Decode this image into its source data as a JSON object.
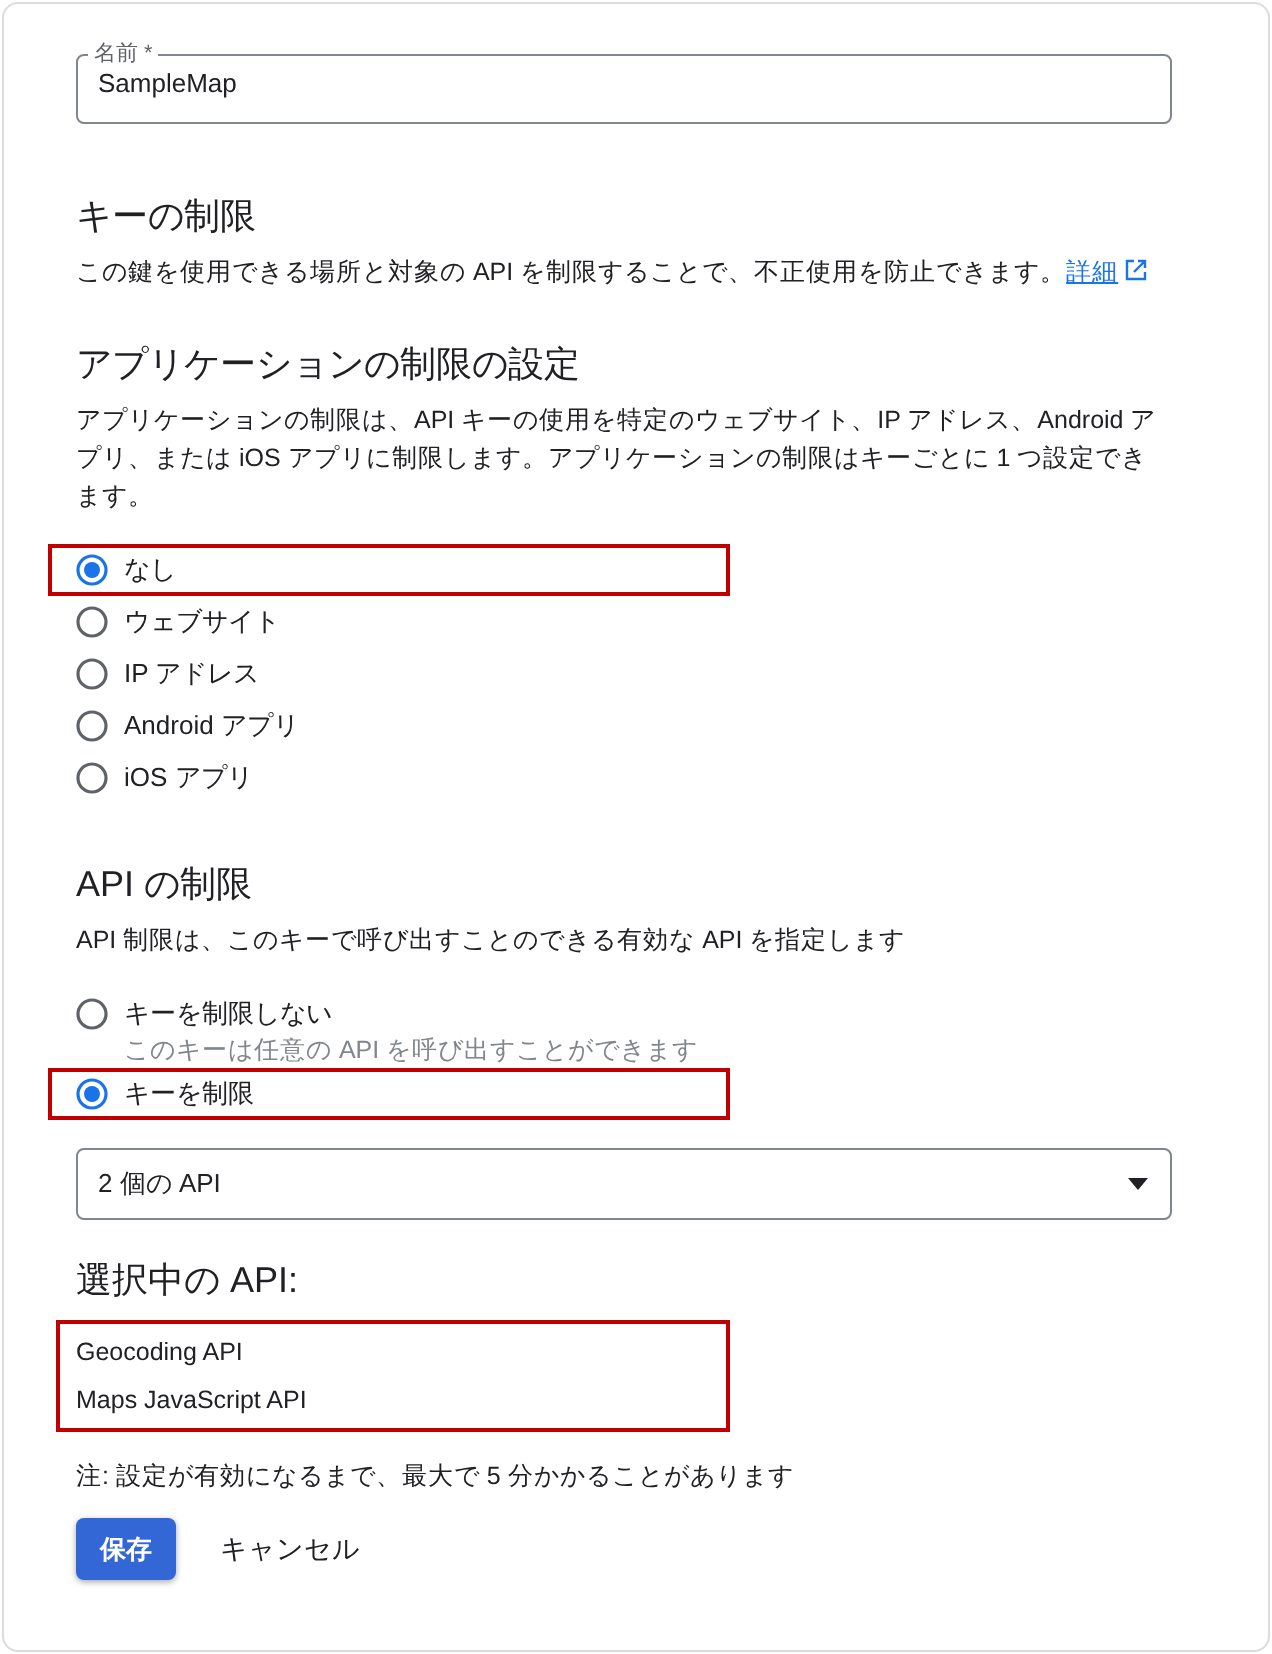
{
  "name_field": {
    "label": "名前 *",
    "value": "SampleMap"
  },
  "key_restrictions": {
    "heading": "キーの制限",
    "description": "この鍵を使用できる場所と対象の API を制限することで、不正使用を防止できます。",
    "link": "詳細"
  },
  "application_restrictions": {
    "heading": "アプリケーションの制限の設定",
    "description": "アプリケーションの制限は、API キーの使用を特定のウェブサイト、IP アドレス、Android アプリ、または iOS アプリに制限します。アプリケーションの制限はキーごとに 1 つ設定できます。",
    "options": [
      {
        "label": "なし",
        "selected": true,
        "highlighted": true
      },
      {
        "label": "ウェブサイト",
        "selected": false,
        "highlighted": false
      },
      {
        "label": "IP アドレス",
        "selected": false,
        "highlighted": false
      },
      {
        "label": "Android アプリ",
        "selected": false,
        "highlighted": false
      },
      {
        "label": "iOS アプリ",
        "selected": false,
        "highlighted": false
      }
    ]
  },
  "api_restrictions": {
    "heading": "API の制限",
    "description": "API 制限は、このキーで呼び出すことのできる有効な API を指定します",
    "options": [
      {
        "label": "キーを制限しない",
        "hint": "このキーは任意の API を呼び出すことができます",
        "selected": false,
        "highlighted": false
      },
      {
        "label": "キーを制限",
        "selected": true,
        "highlighted": true
      }
    ],
    "dropdown": {
      "value": "2 個の API"
    },
    "selected_heading": "選択中の API:",
    "selected_apis": {
      "highlighted": true,
      "items": [
        "Geocoding API",
        "Maps JavaScript API"
      ]
    }
  },
  "note": "注: 設定が有効になるまで、最大で 5 分かかることがあります",
  "buttons": {
    "save": "保存",
    "cancel": "キャンセル"
  }
}
